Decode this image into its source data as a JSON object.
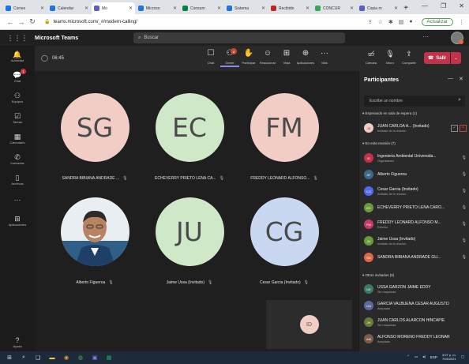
{
  "browser": {
    "tabs": [
      {
        "label": "Correo",
        "color": "#1a73e8",
        "active": false
      },
      {
        "label": "Calendar",
        "color": "#1a73e8",
        "active": false
      },
      {
        "label": "Mo",
        "color": "#5b5fc7",
        "active": true
      },
      {
        "label": "Microso",
        "color": "#1a73e8",
        "active": false
      },
      {
        "label": "Consum",
        "color": "#0b8043",
        "active": false
      },
      {
        "label": "Sistema",
        "color": "#1a73e8",
        "active": false
      },
      {
        "label": "Recibido",
        "color": "#c5221f",
        "active": false
      },
      {
        "label": "CONCUR",
        "color": "#34a853",
        "active": false
      },
      {
        "label": "Copia m",
        "color": "#5b5fc7",
        "active": false
      }
    ],
    "new_tab": "+",
    "url": "teams.microsoft.com/_#/modern-calling/",
    "update_label": "Actualizar"
  },
  "teams": {
    "app_name": "Microsoft Teams",
    "search_placeholder": "Buscar",
    "more": "···",
    "rail": [
      {
        "label": "Actividad",
        "icon": "bell-icon"
      },
      {
        "label": "Chat",
        "icon": "chat-icon",
        "badge": "1"
      },
      {
        "label": "Equipos",
        "icon": "teams-icon"
      },
      {
        "label": "Tareas",
        "icon": "tasks-icon"
      },
      {
        "label": "Calendario",
        "icon": "calendar-icon"
      },
      {
        "label": "Llamadas",
        "icon": "phone-icon"
      },
      {
        "label": "Archivos",
        "icon": "files-icon"
      },
      {
        "label": "",
        "icon": "more-icon"
      },
      {
        "label": "Aplicaciones",
        "icon": "apps-icon"
      }
    ],
    "help_label": "Ayuda"
  },
  "meeting": {
    "time": "06:45",
    "toolbar": [
      {
        "label": "Chat",
        "icon": "chat-icon"
      },
      {
        "label": "Gente",
        "icon": "people-icon",
        "badge": "8",
        "selected": true
      },
      {
        "label": "Participar",
        "icon": "raise-hand-icon"
      },
      {
        "label": "Reaccionar",
        "icon": "smile-icon"
      },
      {
        "label": "Vista",
        "icon": "view-icon"
      },
      {
        "label": "Aplicaciones",
        "icon": "apps-add-icon"
      },
      {
        "label": "Más",
        "icon": "more-icon"
      }
    ],
    "controls": [
      {
        "label": "Cámara",
        "icon": "camera-off-icon"
      },
      {
        "label": "Micro",
        "icon": "mic-off-icon"
      },
      {
        "label": "Compartir",
        "icon": "share-icon"
      }
    ],
    "leave_label": "Salir",
    "tiles": [
      {
        "initials": "SG",
        "name": "SANDRA BIBIANA ANDRADE ...",
        "color": "#f2cdc6"
      },
      {
        "initials": "EC",
        "name": "ECHEVERRY PRIETO LENA CA...",
        "color": "#cfe8c8"
      },
      {
        "initials": "FM",
        "name": "FREDDY LEONARD ALFONSO...",
        "color": "#f2cdc6"
      },
      {
        "initials": "",
        "name": "Alberto Figueroa",
        "color": "#3a6a8a",
        "photo": true
      },
      {
        "initials": "JU",
        "name": "Jaime Ussa (Invitado)",
        "color": "#cfe8c8"
      },
      {
        "initials": "CG",
        "name": "Cesar Garcia (Invitado)",
        "color": "#c9d8f0"
      }
    ],
    "self_view": "ID"
  },
  "panel": {
    "title": "Participantes",
    "search_placeholder": "Escribe un nombre",
    "sections": {
      "waiting": "Esperando en sala de espera (1)",
      "in_meeting": "En esta reunión (7)",
      "others": "Otros invitados (8)"
    },
    "waiting": [
      {
        "initials": "JA",
        "name": "JUAN CARLOA A... (Invitado)",
        "sub": "Invitado de la reunión",
        "color": "#f2cdc6",
        "text": "#8a3a2a"
      }
    ],
    "in_meeting": [
      {
        "initials": "ID",
        "name": "Ingenieria Ambiental Universida...",
        "sub": "Organizador",
        "color": "#c4314b",
        "text": "#ffffff"
      },
      {
        "initials": "AF",
        "name": "Alberto Figueroa",
        "sub": "",
        "color": "#3a6a8a",
        "text": "#ffffff"
      },
      {
        "initials": "CG",
        "name": "Cesar Garcia (Invitado)",
        "sub": "Invitado de la reunión",
        "color": "#4f6bed",
        "text": "#ffffff"
      },
      {
        "initials": "EC",
        "name": "ECHEVERRY PRIETO LENA CARO...",
        "sub": "",
        "color": "#6a9a3a",
        "text": "#ffffff"
      },
      {
        "initials": "FM",
        "name": "FREDDY LEONARD ALFONSO M...",
        "sub": "Externo",
        "color": "#c43a6a",
        "text": "#ffffff"
      },
      {
        "initials": "JU",
        "name": "Jaime Ussa (Invitado)",
        "sub": "Invitado de la reunión",
        "color": "#6a9a3a",
        "text": "#ffffff"
      },
      {
        "initials": "SG",
        "name": "SANDRA BIBIANA ANDRADE GU...",
        "sub": "",
        "color": "#e0684a",
        "text": "#ffffff"
      }
    ],
    "others": [
      {
        "initials": "UE",
        "name": "USSA GARZON JAIME EDDY",
        "sub": "Sin respuesta",
        "color": "#3a7a6a",
        "text": "#ffffff"
      },
      {
        "initials": "GA",
        "name": "GARCIA VALBUENA CESAR AUGUSTO",
        "sub": "Aceptado",
        "color": "#5a6aa0",
        "text": "#ffffff"
      },
      {
        "initials": "JH",
        "name": "JUAN CARLOS ALARCON HINCAPIE",
        "sub": "Sin respuesta",
        "color": "#6a7a3a",
        "text": "#ffffff"
      },
      {
        "initials": "AM",
        "name": "ALFONSO MORENO FREDDY LEONAR",
        "sub": "Aceptado",
        "color": "#7a5a4a",
        "text": "#ffffff"
      }
    ]
  },
  "taskbar": {
    "lang": "ESP",
    "time": "3:07 p. m.",
    "date": "7/05/2021"
  }
}
